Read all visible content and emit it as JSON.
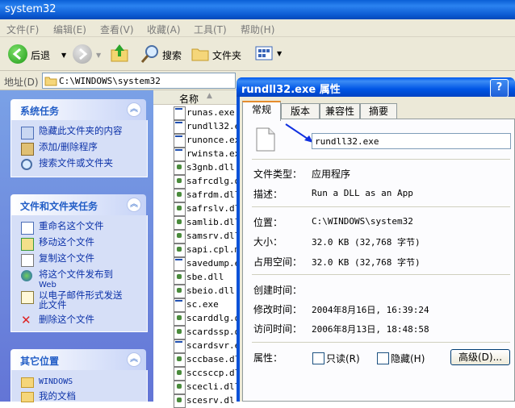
{
  "window": {
    "title": "system32"
  },
  "menu": {
    "items": [
      "文件(F)",
      "编辑(E)",
      "查看(V)",
      "收藏(A)",
      "工具(T)",
      "帮助(H)"
    ]
  },
  "toolbar": {
    "back_label": "后退",
    "search_label": "搜索",
    "folders_label": "文件夹"
  },
  "address": {
    "label": "地址(D)",
    "path": "C:\\WINDOWS\\system32"
  },
  "taskpane": {
    "system_tasks": {
      "title": "系统任务",
      "items": [
        "隐藏此文件夹的内容",
        "添加/删除程序",
        "搜索文件或文件夹"
      ]
    },
    "file_tasks": {
      "title": "文件和文件夹任务",
      "items": [
        "重命名这个文件",
        "移动这个文件",
        "复制这个文件",
        "将这个文件发布到",
        "Web",
        "以电子邮件形式发送",
        "此文件",
        "删除这个文件"
      ]
    },
    "other_places": {
      "title": "其它位置",
      "items": [
        "WINDOWS",
        "我的文档"
      ]
    }
  },
  "filelist": {
    "header": "名称",
    "files": [
      "runas.exe",
      "rundll32.e",
      "runonce.ex",
      "rwinsta.ex",
      "s3gnb.dll",
      "safrcdlg.d",
      "safrdm.dll",
      "safrslv.dl",
      "samlib.dll",
      "samsrv.dll",
      "sapi.cpl.m",
      "savedump.e",
      "sbe.dll",
      "sbeio.dll",
      "sc.exe",
      "scarddlg.d",
      "scardssp.d",
      "scardsvr.e",
      "sccbase.dl",
      "sccsccp.dl",
      "scecli.dll",
      "scesrv.dl"
    ]
  },
  "dialog": {
    "title": "rundll32.exe 属性",
    "help_btn": "?",
    "close_btn": "X",
    "tabs": [
      "常规",
      "版本",
      "兼容性",
      "摘要"
    ],
    "filename": "rundll32.exe",
    "fields": [
      {
        "label": "文件类型：",
        "value": "应用程序"
      },
      {
        "label": "描述：",
        "value": "Run a DLL as an App"
      },
      {
        "label": "位置：",
        "value": "C:\\WINDOWS\\system32"
      },
      {
        "label": "大小：",
        "value": "32.0 KB (32,768 字节)"
      },
      {
        "label": "占用空间：",
        "value": "32.0 KB (32,768 字节)"
      },
      {
        "label": "创建时间：",
        "value": ""
      },
      {
        "label": "修改时间：",
        "value": "2004年8月16日, 16:39:24"
      },
      {
        "label": "访问时间：",
        "value": "2006年8月13日, 18:48:58"
      }
    ],
    "attributes_label": "属性：",
    "readonly_label": "只读(R)",
    "hidden_label": "隐藏(H)",
    "advanced_button": "高级(D)..."
  }
}
